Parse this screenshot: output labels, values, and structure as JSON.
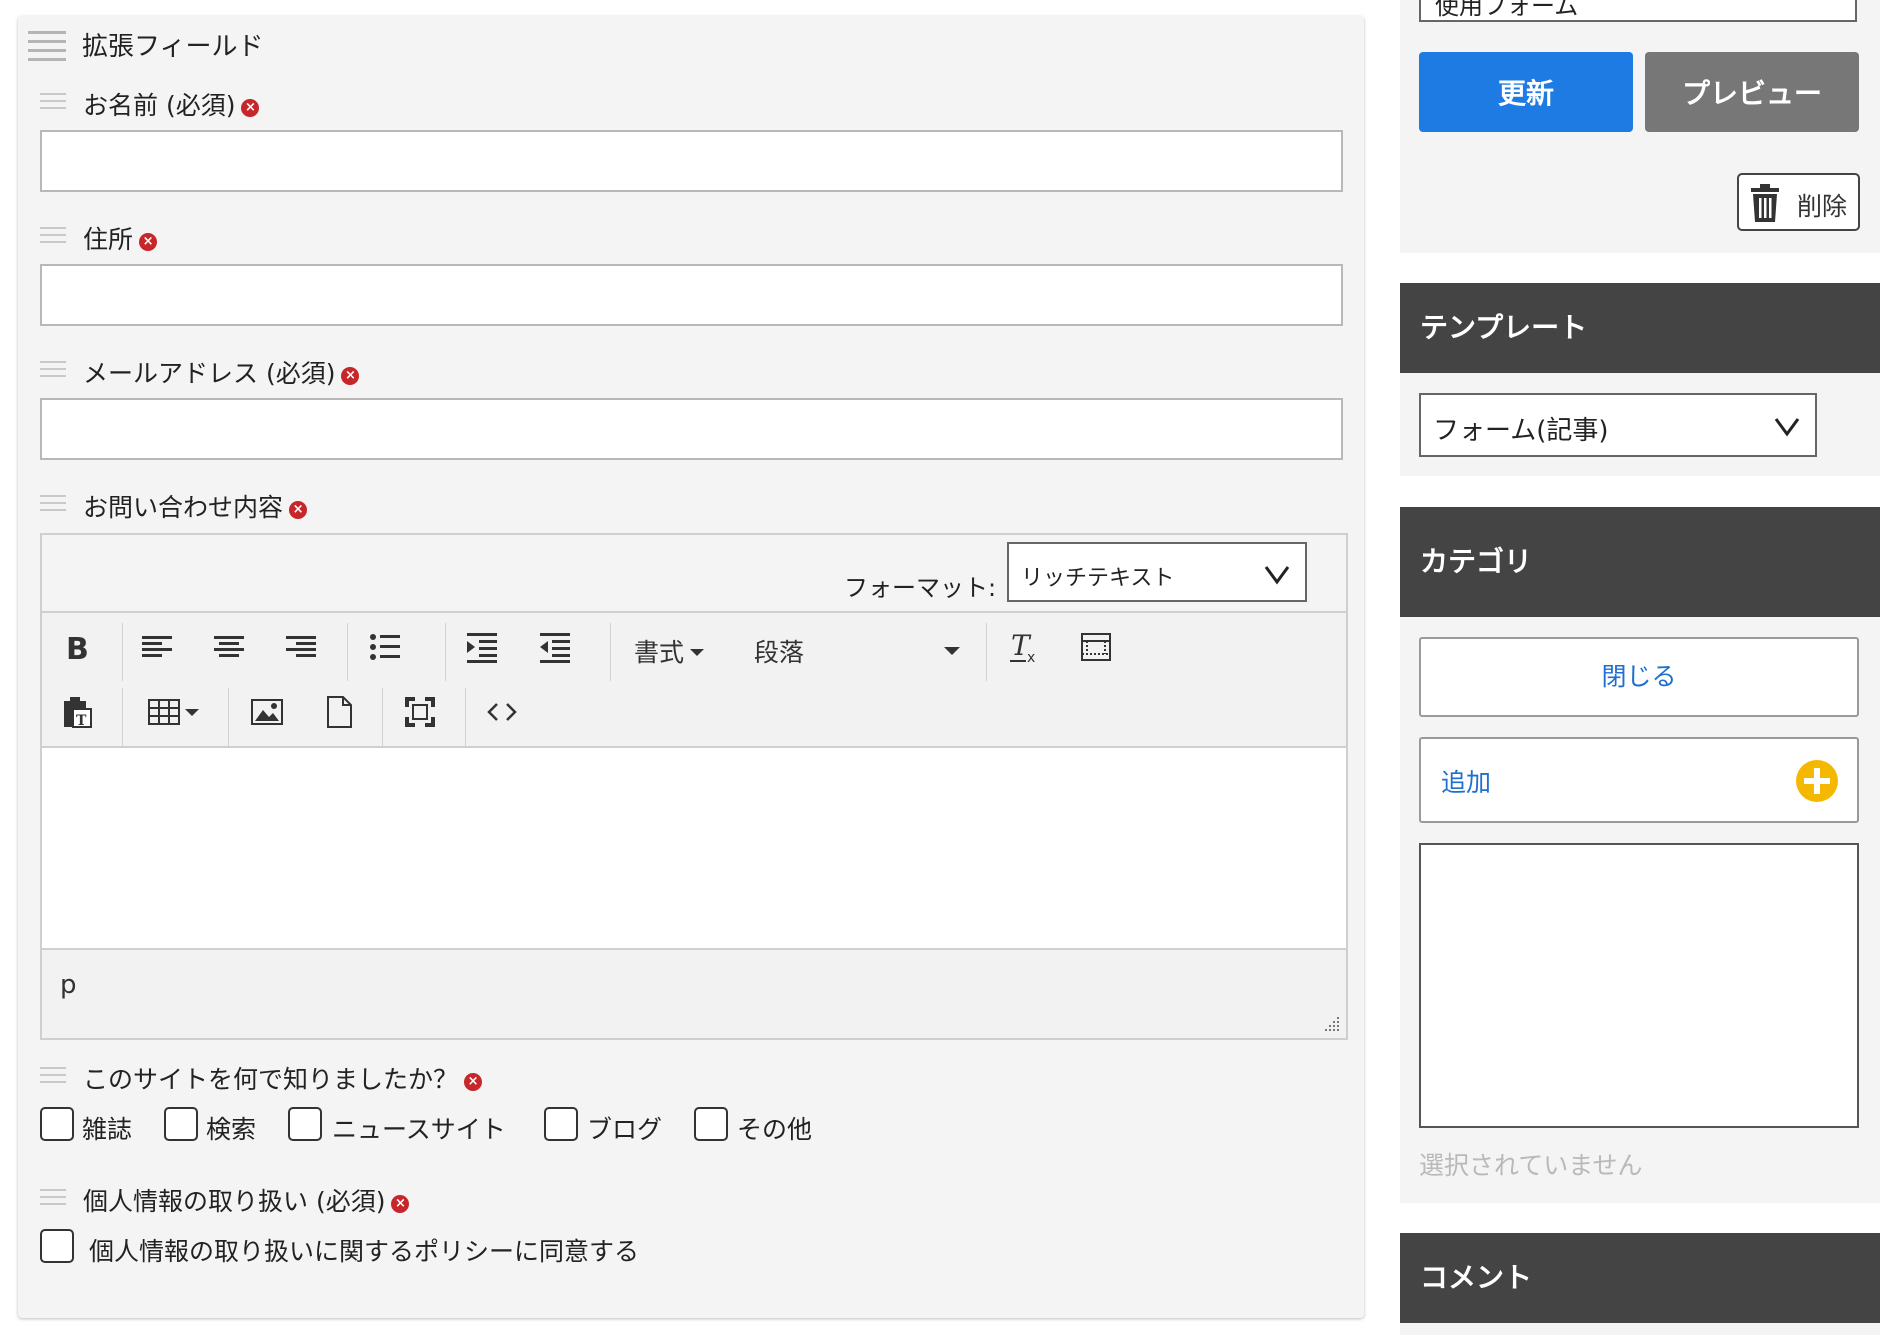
{
  "main": {
    "title": "拡張フィールド",
    "fields": {
      "name_label": "お名前 (必須)",
      "address_label": "住所",
      "email_label": "メールアドレス (必須)",
      "inquiry_label": "お問い合わせ内容",
      "source_label": "このサイトを何で知りましたか？",
      "privacy_label": "個人情報の取り扱い (必須)"
    },
    "remove_glyph": "×",
    "editor": {
      "format_label": "フォーマット:",
      "format_value": "リッチテキスト",
      "style_menu": "書式",
      "block_menu": "段落",
      "status_path": "p"
    },
    "source_options": [
      "雑誌",
      "検索",
      "ニュースサイト",
      "ブログ",
      "その他"
    ],
    "privacy_option": "個人情報の取り扱いに関するポリシーに同意する"
  },
  "sidebar": {
    "status_select_partial": "使用フォーム",
    "update_button": "更新",
    "preview_button": "プレビュー",
    "delete_button": "削除",
    "template_heading": "テンプレート",
    "template_value": "フォーム(記事)",
    "category_heading": "カテゴリ",
    "close_button": "閉じる",
    "add_button": "追加",
    "none_selected": "選択されていません",
    "comment_heading": "コメント"
  },
  "colors": {
    "primary": "#1e7be3",
    "secondary": "#777777",
    "required_icon": "#c5272b",
    "add_icon": "#f5b800",
    "heading_bg": "#444444",
    "link": "#1f6fd0"
  },
  "icons": [
    "drag-handle-icon",
    "remove-icon",
    "bold-icon",
    "align-left-icon",
    "align-center-icon",
    "align-right-icon",
    "bullet-list-icon",
    "indent-icon",
    "outdent-icon",
    "clear-format-icon",
    "table-grid-icon",
    "paste-text-icon",
    "insert-table-icon",
    "image-icon",
    "document-icon",
    "fullscreen-icon",
    "source-code-icon",
    "trash-icon",
    "plus-circle-icon",
    "chevron-down-icon"
  ]
}
